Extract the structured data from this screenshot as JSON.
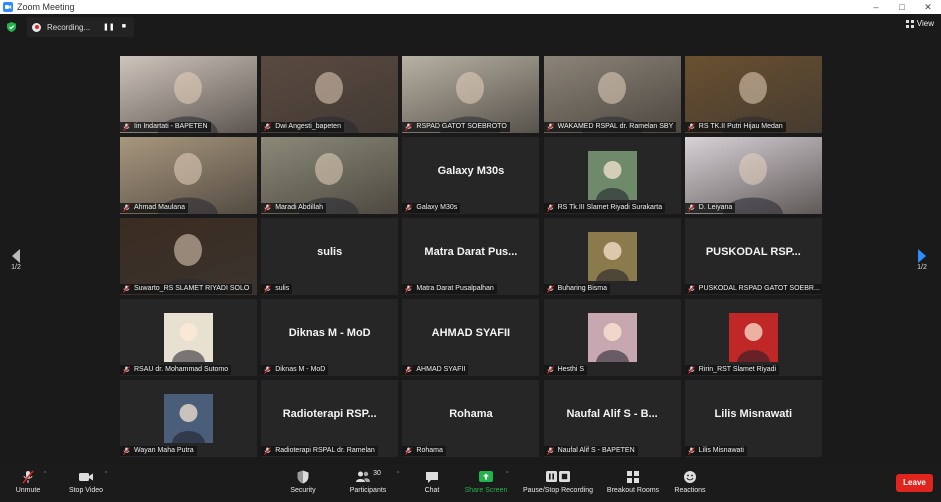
{
  "window": {
    "title": "Zoom Meeting"
  },
  "recording": {
    "label": "Recording..."
  },
  "view": {
    "label": "View"
  },
  "pagination": {
    "left": "1/2",
    "right": "1/2"
  },
  "tiles": [
    {
      "name": "Iin Indartati - BAPETEN",
      "video": true,
      "bg": "#cfc4bc"
    },
    {
      "name": "Dwi Angesti_bapeten",
      "video": true,
      "bg": "#5a4a40"
    },
    {
      "name": "RSPAD GATOT SOEBROTO",
      "video": true,
      "bg": "#b8b2a4"
    },
    {
      "name": "WAKAMED RSPAL dr. Ramelan SBY",
      "video": true,
      "bg": "#8c8478"
    },
    {
      "name": "RS TK.II Putri Hijau Medan",
      "video": true,
      "bg": "#6a5030"
    },
    {
      "name": "Ahmad Maulana",
      "video": true,
      "bg": "#a8977e"
    },
    {
      "name": "Maradi Abdillah",
      "video": true,
      "bg": "#8b8a78",
      "active": true
    },
    {
      "name": "Galaxy M30s",
      "display": "Galaxy M30s",
      "video": false
    },
    {
      "name": "RS Tk.III Slamet Riyadi Surakarta",
      "video": false,
      "thumb": "#6e8a6a"
    },
    {
      "name": "D. Leiyana",
      "video": true,
      "bg": "#d8d2d8"
    },
    {
      "name": "Suwarto_RS SLAMET RIYADI SOLO",
      "video": true,
      "bg": "#3a2c22"
    },
    {
      "name": "sulis",
      "display": "sulis",
      "video": false
    },
    {
      "name": "Matra Darat Pusalpalhan",
      "display": "Matra Darat Pus...",
      "video": false
    },
    {
      "name": "Buharing Bisma",
      "video": false,
      "thumb": "#8a7a4c"
    },
    {
      "name": "PUSKODAL RSPAD GATOT SOEBR...",
      "display": "PUSKODAL RSP...",
      "video": false
    },
    {
      "name": "RSAU dr. Mohammad Sutomo",
      "video": false,
      "thumb": "#e8e0d0"
    },
    {
      "name": "Diknas M - MoD",
      "display": "Diknas M - MoD",
      "video": false
    },
    {
      "name": "AHMAD SYAFII",
      "display": "AHMAD SYAFII",
      "video": false
    },
    {
      "name": "Hesthi S",
      "video": false,
      "thumb": "#c8a8b0"
    },
    {
      "name": "Ririn_RST Slamet Riyadi",
      "video": false,
      "thumb": "#c02828"
    },
    {
      "name": "Wayan Maha Putra",
      "video": false,
      "thumb": "#4a5e7a"
    },
    {
      "name": "Radioterapi RSPAL dr. Ramelan",
      "display": "Radioterapi RSP...",
      "video": false
    },
    {
      "name": "Rohama",
      "display": "Rohama",
      "video": false
    },
    {
      "name": "Naufal Alif S - BAPETEN",
      "display": "Naufal Alif S - B...",
      "video": false
    },
    {
      "name": "Lilis Misnawati",
      "display": "Lilis Misnawati",
      "video": false
    }
  ],
  "toolbar": {
    "unmute": "Unmute",
    "stop_video": "Stop Video",
    "security": "Security",
    "participants": "Participants",
    "participants_count": "30",
    "chat": "Chat",
    "share_screen": "Share Screen",
    "pause_recording": "Pause/Stop Recording",
    "breakout": "Breakout Rooms",
    "reactions": "Reactions",
    "leave": "Leave"
  },
  "colors": {
    "accent_green": "#22b34a",
    "leave_red": "#e0251e",
    "active_speaker": "#e5e35c"
  }
}
